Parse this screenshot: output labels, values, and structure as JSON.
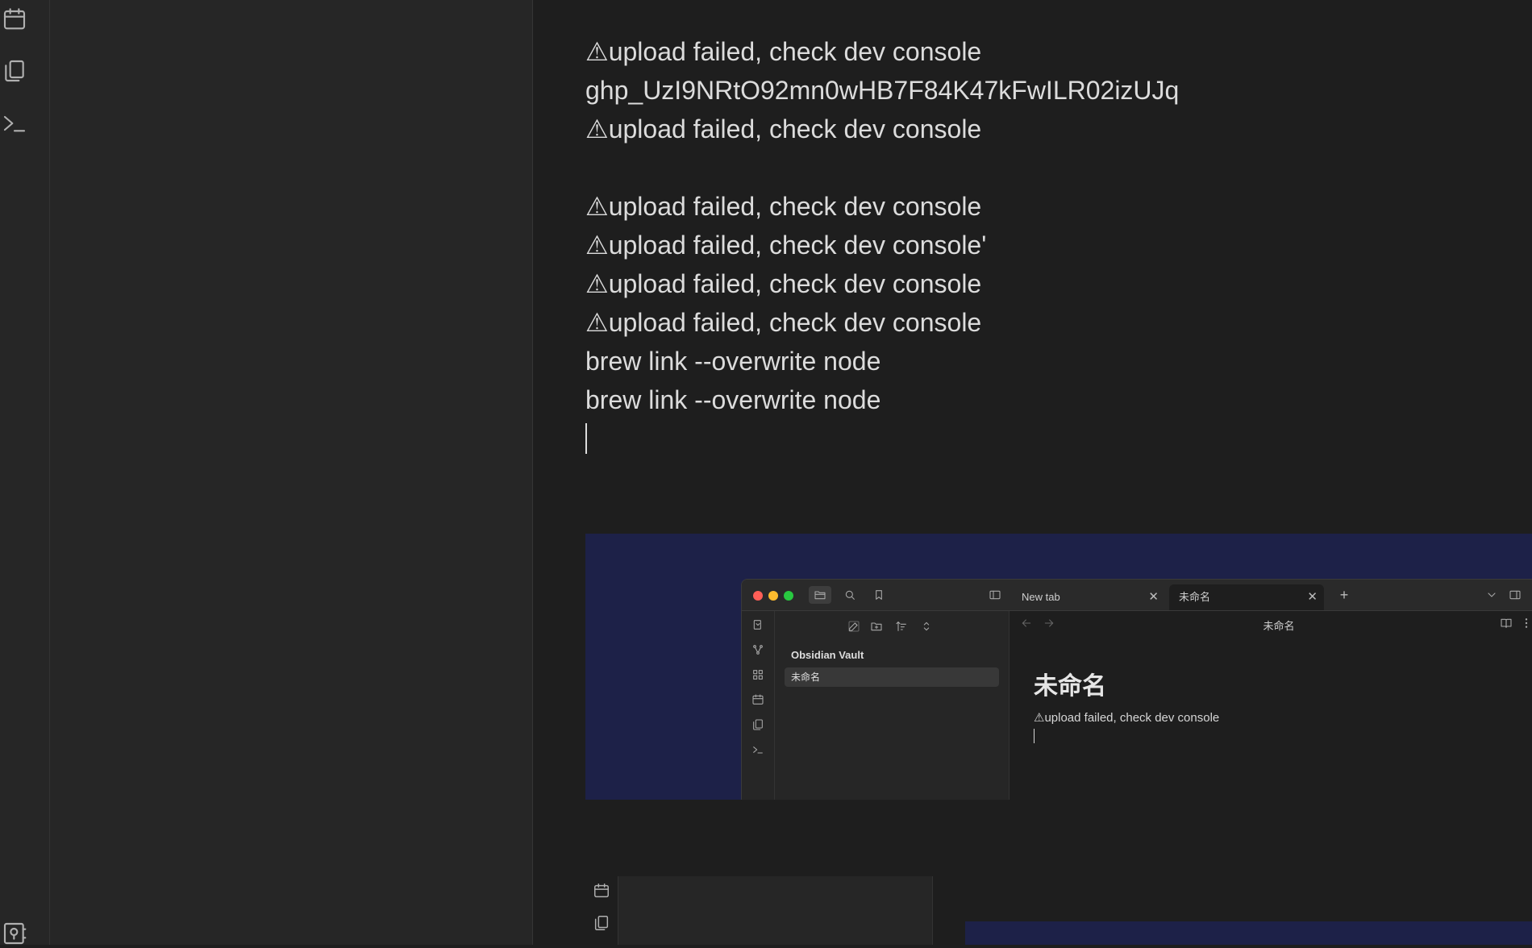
{
  "ribbon": {
    "icons": [
      "calendar-icon",
      "files-icon",
      "terminal-icon",
      "vault-icon"
    ]
  },
  "editor": {
    "lines": [
      "⚠upload failed, check dev console",
      "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",
      "⚠upload failed, check dev console",
      "",
      "⚠upload failed, check dev console",
      "⚠upload failed, check dev console'",
      "⚠upload failed, check dev console",
      "⚠upload failed, check dev console",
      "brew link --overwrite node",
      "brew link --overwrite node"
    ]
  },
  "embedded_screenshot": {
    "tabs": [
      {
        "label": "New tab",
        "close": "✕"
      },
      {
        "label": "未命名",
        "close": "✕"
      }
    ],
    "new_tab": "+",
    "vault_name": "Obsidian Vault",
    "file_item": "未命名",
    "view_title": "未命名",
    "note_heading": "未命名",
    "note_text": "⚠upload failed, check dev console",
    "colors": {
      "close": "#ff5f57",
      "minimize": "#febc2e",
      "zoom": "#28c840",
      "background": "#1d2148"
    }
  }
}
